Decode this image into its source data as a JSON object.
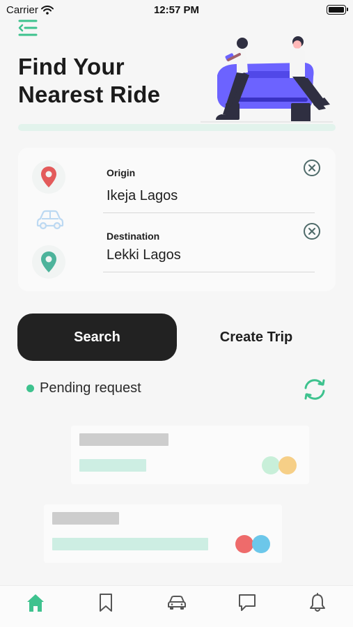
{
  "status_bar": {
    "carrier": "Carrier",
    "time": "12:57 PM"
  },
  "header": {
    "menu_icon": "menu-back-icon",
    "title_line1": "Find Your",
    "title_line2": "Nearest Ride"
  },
  "route": {
    "origin": {
      "label": "Origin",
      "value": "Ikeja Lagos"
    },
    "destination": {
      "label": "Destination",
      "value": "Lekki Lagos"
    }
  },
  "actions": {
    "search_label": "Search",
    "create_trip_label": "Create Trip"
  },
  "pending": {
    "label": "Pending request"
  },
  "colors": {
    "accent_green": "#3ec28e",
    "origin_pin": "#e35b5b",
    "destination_pin": "#4db39b",
    "dark_button": "#222222",
    "illustration_car": "#6c63ff"
  },
  "tabs": [
    {
      "icon": "home-icon",
      "active": true
    },
    {
      "icon": "bookmark-icon",
      "active": false
    },
    {
      "icon": "car-icon",
      "active": false
    },
    {
      "icon": "chat-icon",
      "active": false
    },
    {
      "icon": "bell-icon",
      "active": false
    }
  ]
}
